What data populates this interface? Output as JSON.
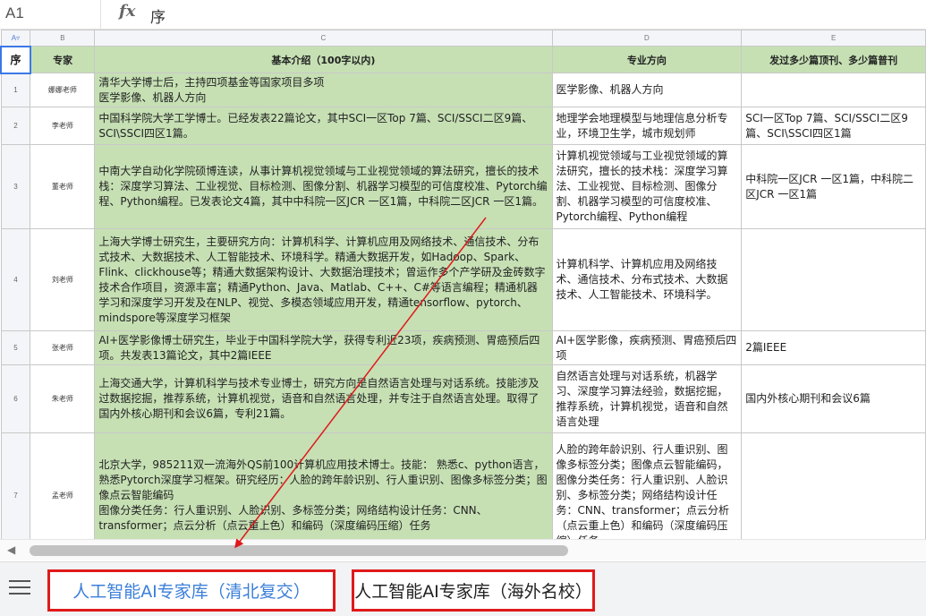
{
  "formula_bar": {
    "cell_ref": "A1",
    "fx_label": "fx",
    "value": "序"
  },
  "columns": [
    "A",
    "B",
    "C",
    "D",
    "E"
  ],
  "header": {
    "seq": "序",
    "expert": "专家",
    "intro": "基本介绍（100字以内)",
    "direction": "专业方向",
    "papers": "发过多少篇顶刊、多少篇普刊"
  },
  "rows": [
    {
      "num": "1",
      "name": "娜娜老师",
      "intro": "清华大学博士后，主持四项基金等国家项目多项\n医学影像、机器人方向",
      "direction": "医学影像、机器人方向",
      "papers": ""
    },
    {
      "num": "2",
      "name": "李老师",
      "intro": "中国科学院大学工学博士。已经发表22篇论文，其中SCI一区Top 7篇、SCI/SSCI二区9篇、SCI\\SSCI四区1篇。",
      "direction": "地理学会地理模型与地理信息分析专业，环境卫生学，城市规划师",
      "papers": "SCI一区Top 7篇、SCI/SSCI二区9篇、SCI\\SSCI四区1篇"
    },
    {
      "num": "3",
      "name": "董老师",
      "intro": "中南大学自动化学院硕博连读，从事计算机视觉领域与工业视觉领域的算法研究，擅长的技术栈：深度学习算法、工业视觉、目标检测、图像分割、机器学习模型的可信度校准、Pytorch编程、Python编程。已发表论文4篇，其中中科院一区JCR 一区1篇，中科院二区JCR 一区1篇。",
      "direction": "计算机视觉领域与工业视觉领域的算法研究，擅长的技术栈：深度学习算法、工业视觉、目标检测、图像分割、机器学习模型的可信度校准、Pytorch编程、Python编程",
      "papers": "中科院一区JCR 一区1篇，中科院二区JCR 一区1篇"
    },
    {
      "num": "4",
      "name": "刘老师",
      "intro": "上海大学博士研究生，主要研究方向：计算机科学、计算机应用及网络技术、通信技术、分布式技术、大数据技术、人工智能技术、环境科学。精通大数据开发，如Hadoop、Spark、Flink、clickhouse等；精通大数据架构设计、大数据治理技术；曾运作多个产学研及金砖数字技术合作项目，资源丰富；精通Python、Java、Matlab、C++、C#等语言编程；精通机器学习和深度学习开发及在NLP、视觉、多模态领域应用开发，精通tensorflow、pytorch、mindspore等深度学习框架",
      "direction": "计算机科学、计算机应用及网络技术、通信技术、分布式技术、大数据技术、人工智能技术、环境科学。",
      "papers": ""
    },
    {
      "num": "5",
      "name": "张老师",
      "intro": "AI+医学影像博士研究生，毕业于中国科学院大学，获得专利近23项，疾病预测、胃癌预后四项。共发表13篇论文，其中2篇IEEE",
      "direction": "AI+医学影像，疾病预测、胃癌预后四项",
      "papers": "2篇IEEE"
    },
    {
      "num": "6",
      "name": "朱老师",
      "intro": " 上海交通大学，计算机科学与技术专业博士，研究方向是自然语言处理与对话系统。技能涉及过数据挖掘，推荐系统，计算机视觉，语音和自然语言处理，并专注于自然语言处理。取得了国内外核心期刊和会议6篇，专利21篇。",
      "direction": "自然语言处理与对话系统，机器学习、深度学习算法经验，数据挖掘，推荐系统，计算机视觉，语音和自然语言处理",
      "papers": "国内外核心期刊和会议6篇"
    },
    {
      "num": "7",
      "name": "孟老师",
      "intro": "北京大学，985211双一流海外QS前100计算机应用技术博士。技能： 熟悉c、python语言，熟悉Pytorch深度学习框架。研究经历：人脸的跨年龄识别、行人重识别、图像多标签分类；图像点云智能编码\n图像分类任务：行人重识别、人脸识别、多标签分类；网络结构设计任务：CNN、transformer；点云分析（点云重上色）和编码（深度编码压缩）任务",
      "direction": "人脸的跨年龄识别、行人重识别、图像多标签分类；图像点云智能编码，图像分类任务：行人重识别、人脸识别、多标签分类；网络结构设计任务：CNN、transformer；点云分析（点云重上色）和编码（深度编码压缩）任务",
      "papers": ""
    }
  ],
  "scrollbar": {
    "left_arrow": "◀"
  },
  "sheet_tabs": [
    {
      "label": "人工智能AI专家库（清北复交）"
    },
    {
      "label": "人工智能AI专家库（海外名校）"
    }
  ],
  "colors": {
    "header_green": "#c6e0b4",
    "highlight_red": "#e0191b",
    "active_tab_blue": "#3b7fd9"
  }
}
